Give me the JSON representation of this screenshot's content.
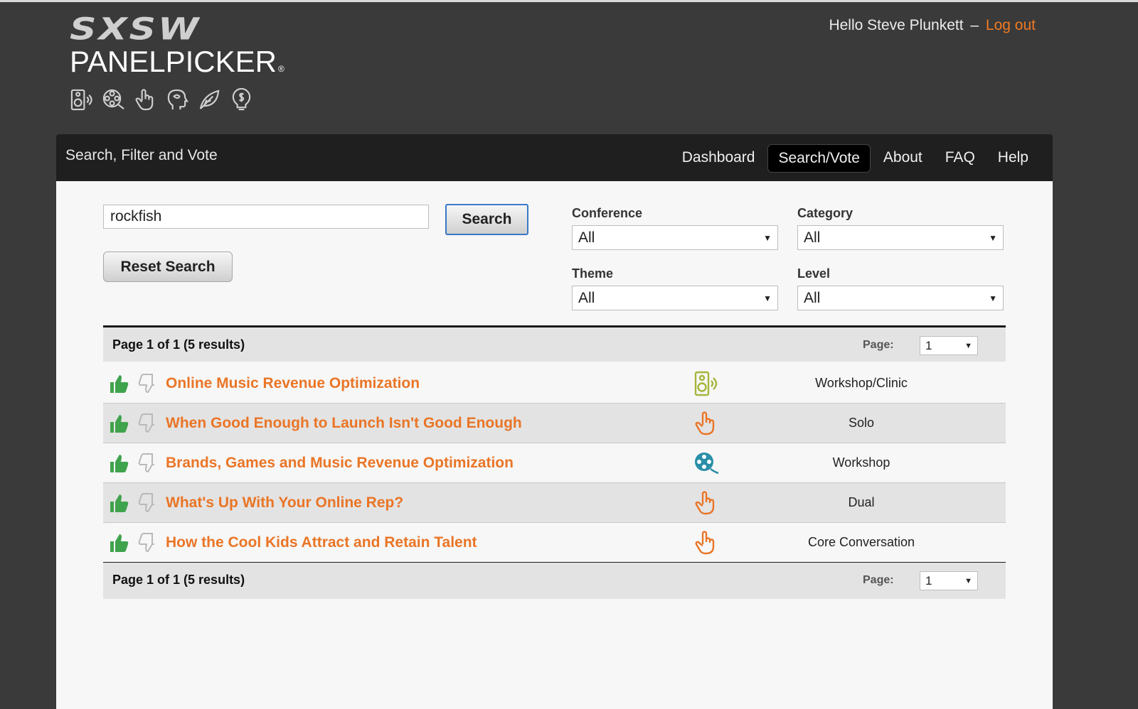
{
  "header": {
    "logo_top": "SXSW",
    "logo_bottom": "PANELPICKER",
    "logo_reg": "®",
    "greeting": "Hello Steve Plunkett",
    "dash": "–",
    "logout": "Log out"
  },
  "nav": {
    "breadcrumb": "Search, Filter and Vote",
    "items": [
      {
        "label": "Dashboard",
        "active": false
      },
      {
        "label": "Search/Vote",
        "active": true
      },
      {
        "label": "About",
        "active": false
      },
      {
        "label": "FAQ",
        "active": false
      },
      {
        "label": "Help",
        "active": false
      }
    ]
  },
  "search": {
    "value": "rockfish",
    "search_button": "Search",
    "reset_button": "Reset Search"
  },
  "filters": {
    "conference": {
      "label": "Conference",
      "value": "All"
    },
    "category": {
      "label": "Category",
      "value": "All"
    },
    "theme": {
      "label": "Theme",
      "value": "All"
    },
    "level": {
      "label": "Level",
      "value": "All"
    }
  },
  "pager": {
    "info": "Page 1 of 1 (5 results)",
    "label": "Page:",
    "value": "1"
  },
  "results": [
    {
      "title": "Online Music Revenue Optimization",
      "icon": "music-speaker-icon",
      "format": "Workshop/Clinic"
    },
    {
      "title": "When Good Enough to Launch Isn't Good Enough",
      "icon": "interactive-hand-icon",
      "format": "Solo"
    },
    {
      "title": "Brands, Games and Music Revenue Optimization",
      "icon": "film-reel-icon",
      "format": "Workshop"
    },
    {
      "title": "What's Up With Your Online Rep?",
      "icon": "interactive-hand-icon",
      "format": "Dual"
    },
    {
      "title": "How the Cool Kids Attract and Retain Talent",
      "icon": "interactive-hand-icon",
      "format": "Core Conversation"
    }
  ],
  "colors": {
    "accent_orange": "#ea7526",
    "thumb_green": "#3fa34d",
    "music_green": "#a7b53a",
    "film_teal": "#2a8fa8"
  }
}
